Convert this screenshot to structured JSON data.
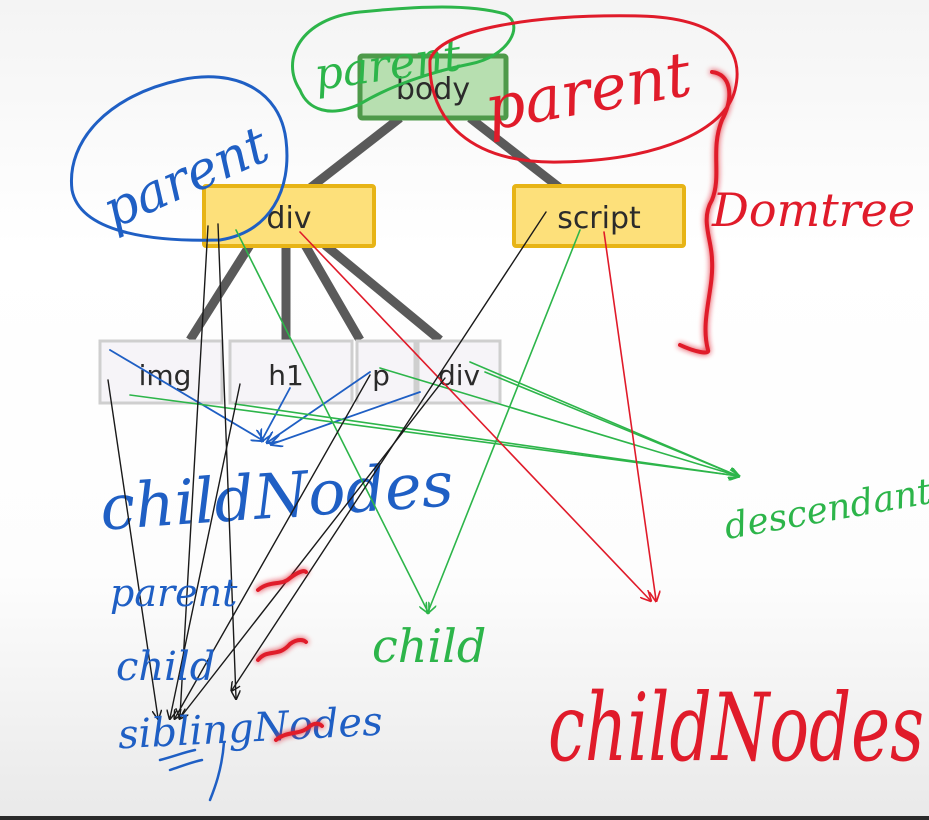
{
  "tree": {
    "root": {
      "label": "body",
      "fill": "#b7dfb0",
      "stroke": "#4e9a4a"
    },
    "level1": [
      {
        "label": "div",
        "fill": "#fde07a",
        "stroke": "#e7b416"
      },
      {
        "label": "script",
        "fill": "#fde07a",
        "stroke": "#e7b416"
      }
    ],
    "level2": [
      {
        "label": "img"
      },
      {
        "label": "h1"
      },
      {
        "label": "p"
      },
      {
        "label": "div"
      }
    ],
    "leaf_fill": "#f6f4f8",
    "leaf_stroke": "#cfcfcf"
  },
  "annotations": {
    "parent_blue": "parent",
    "parent_green": "parent",
    "parent_red": "parent",
    "domtree": "Domtree",
    "childNodes_blue": "childNodes",
    "descendants": "descendants",
    "parent_small": "parent",
    "child_small": "child",
    "siblingNodes": "siblingNodes",
    "child_green": "child",
    "childNodes_red": "childNodes"
  },
  "colors": {
    "blue_ink": "#1f5fc4",
    "green_ink": "#2db54a",
    "red_ink": "#e01b2a",
    "black_ink": "#1a1a1a"
  }
}
